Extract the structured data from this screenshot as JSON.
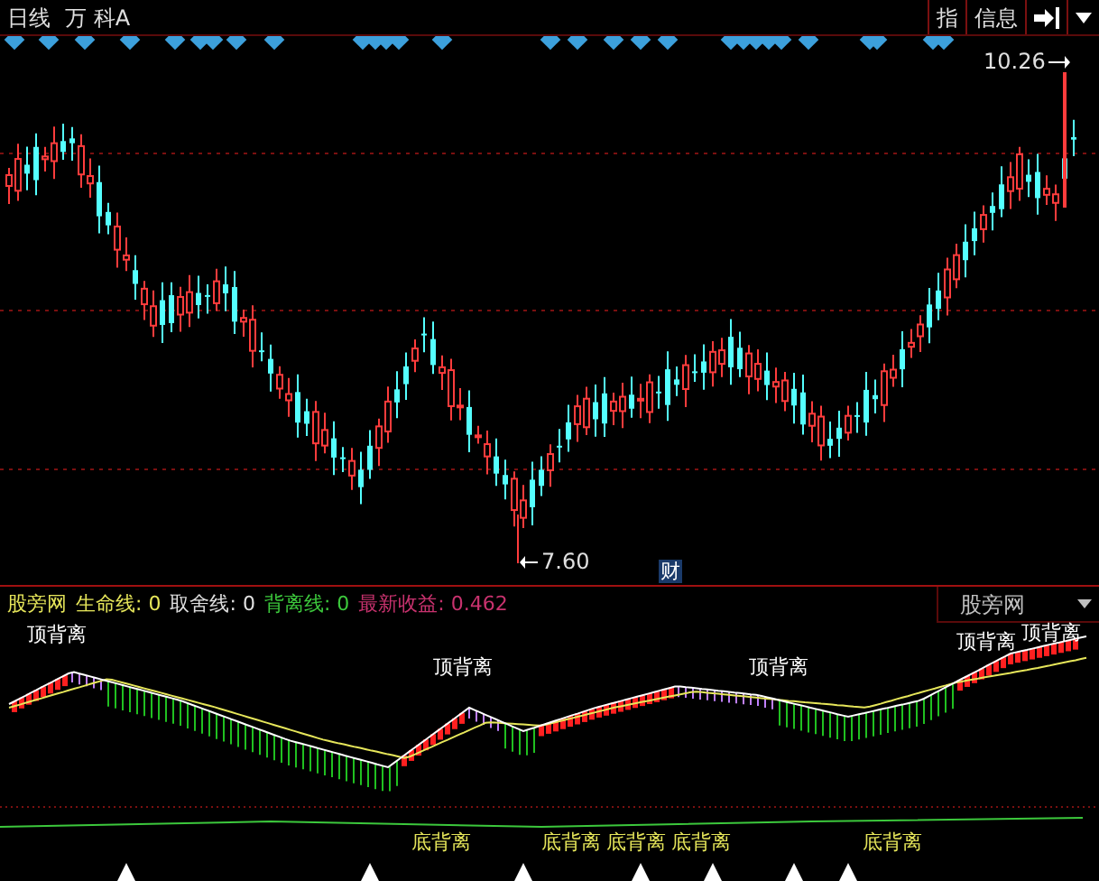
{
  "header": {
    "period": "日线",
    "stock": "万 科A",
    "buttons": [
      {
        "label": "指"
      },
      {
        "label": "信息"
      }
    ]
  },
  "price_chart": {
    "high_label": "10.26",
    "low_label": "7.60",
    "event_badge": "财"
  },
  "indicator": {
    "name": "股旁网",
    "fields": [
      {
        "label": "生命线:",
        "value": "0",
        "color": "#e6e65a"
      },
      {
        "label": "取舍线:",
        "value": "0",
        "color": "#e0e0e0"
      },
      {
        "label": "背离线:",
        "value": "0",
        "color": "#3cc83c"
      },
      {
        "label": "最新收益:",
        "value": "0.462",
        "color": "#c8326e"
      }
    ],
    "selector": "股旁网",
    "top_labels": [
      "顶背离",
      "顶背离",
      "顶背离",
      "顶背离",
      "顶背离"
    ],
    "bottom_labels": [
      "底背离",
      "底背离",
      "底背离",
      "底背离",
      "底背离"
    ]
  }
}
